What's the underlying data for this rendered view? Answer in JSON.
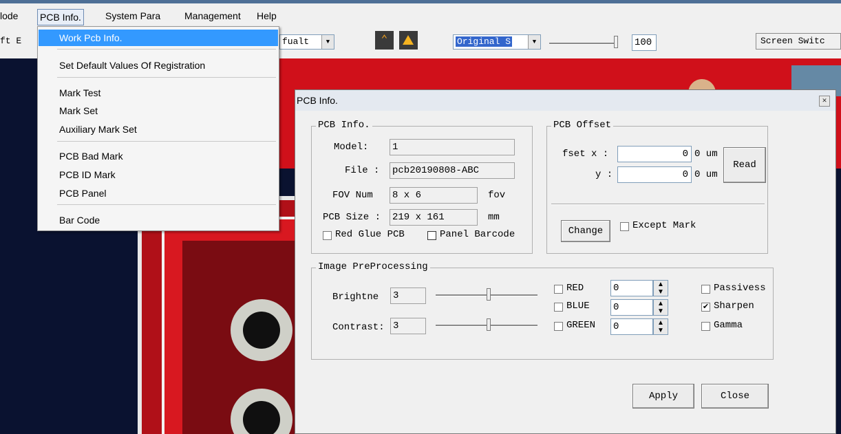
{
  "menubar": {
    "items": [
      "lode",
      "PCB Info.",
      "System Para",
      "Management",
      "Help"
    ]
  },
  "toolbar": {
    "left_text": "ft  E",
    "combo1_value": "fualt",
    "combo2_value": "Original S",
    "zoom_value": "100",
    "screen_switch_label": "Screen Switc"
  },
  "dropdown": {
    "items": [
      "Work Pcb Info.",
      "Set Default Values Of Registration",
      "Mark Test",
      "Mark Set",
      "Auxiliary Mark Set",
      "PCB Bad Mark",
      "PCB ID Mark",
      "PCB Panel",
      "Bar Code"
    ]
  },
  "dialog": {
    "title": "PCB Info.",
    "pcb_info": {
      "legend": "PCB Info.",
      "model_label": "Model:",
      "model_value": "1",
      "file_label": "File :",
      "file_value": "pcb20190808-ABC",
      "fov_label": "FOV Num",
      "fov_value": "8 x 6",
      "fov_unit": "fov",
      "size_label": "PCB Size :",
      "size_value": "219 x 161",
      "size_unit": "mm",
      "red_glue_label": "Red Glue PCB",
      "panel_barcode_label": "Panel Barcode"
    },
    "pcb_offset": {
      "legend": "PCB Offset",
      "x_label": "fset x :",
      "x_value": "0",
      "x_unit": "0 um",
      "y_label": "y :",
      "y_value": "0",
      "y_unit": "0 um",
      "read_label": "Read",
      "change_label": "Change",
      "except_mark_label": "Except Mark"
    },
    "image_pre": {
      "legend": "Image PreProcessing",
      "brightness_label": "Brightne",
      "brightness_value": "3",
      "contrast_label": "Contrast:",
      "contrast_value": "3",
      "red_label": "RED",
      "red_value": "0",
      "blue_label": "BLUE",
      "blue_value": "0",
      "green_label": "GREEN",
      "green_value": "0",
      "passivess_label": "Passivess",
      "sharpen_label": "Sharpen",
      "sharpen_checked": true,
      "gamma_label": "Gamma"
    },
    "apply_label": "Apply",
    "close_label": "Close"
  }
}
